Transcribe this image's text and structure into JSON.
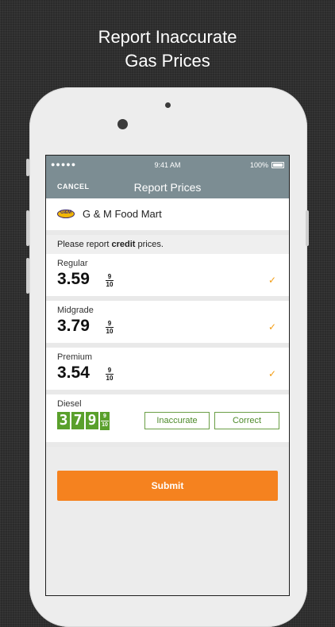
{
  "headline": {
    "line1": "Report Inaccurate",
    "line2": "Gas Prices"
  },
  "status_bar": {
    "signal": "●●●●●",
    "time": "9:41 AM",
    "battery": "100%"
  },
  "nav": {
    "cancel": "CANCEL",
    "title": "Report Prices"
  },
  "station": {
    "logo_text": "G&M",
    "name": "G & M Food Mart"
  },
  "notice": {
    "prefix": "Please report ",
    "emphasis": "credit",
    "suffix": " prices."
  },
  "fuel": [
    {
      "grade": "Regular",
      "price": "3.59",
      "frac_num": "9",
      "frac_den": "10",
      "check": "✓"
    },
    {
      "grade": "Midgrade",
      "price": "3.79",
      "frac_num": "9",
      "frac_den": "10",
      "check": "✓"
    },
    {
      "grade": "Premium",
      "price": "3.54",
      "frac_num": "9",
      "frac_den": "10",
      "check": "✓"
    }
  ],
  "diesel": {
    "grade": "Diesel",
    "digits": [
      "3",
      "7",
      "9"
    ],
    "frac_num": "9",
    "frac_den": "10",
    "inaccurate_label": "Inaccurate",
    "correct_label": "Correct"
  },
  "submit_label": "Submit",
  "colors": {
    "nav_bg": "#7c8d93",
    "accent_orange": "#f5821f",
    "check_orange": "#f39c12",
    "board_green": "#5aa02c",
    "outline_green": "#6a9e45"
  }
}
